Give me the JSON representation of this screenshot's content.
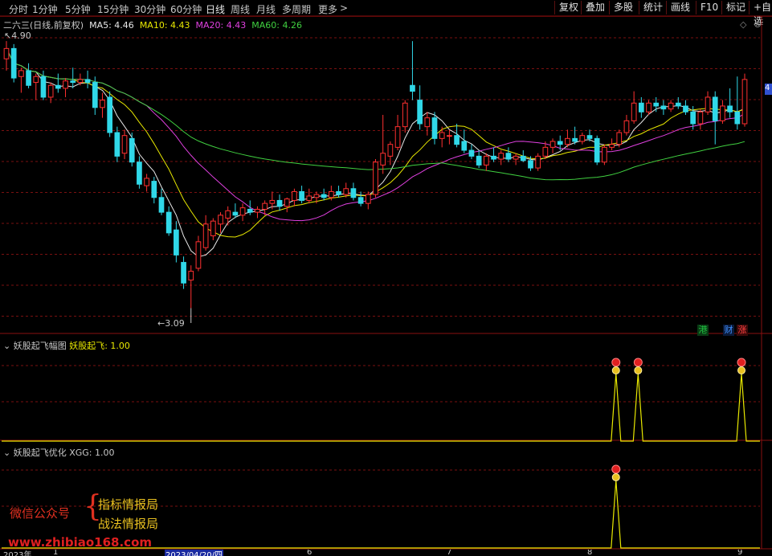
{
  "toolbar": {
    "timeframes": [
      "分时",
      "1分钟",
      "5分钟",
      "15分钟",
      "30分钟",
      "60分钟",
      "日线",
      "周线",
      "月线",
      "多周期",
      "更多"
    ],
    "more_arrow": ">",
    "right_buttons": [
      "复权",
      "叠加",
      "多股",
      "统计",
      "画线",
      "F10",
      "标记",
      "+自选"
    ]
  },
  "main_chart": {
    "stock_title": "二六三(日线,前复权)",
    "ma": [
      {
        "label": "MA5: 4.46",
        "color": "#e8e8e8"
      },
      {
        "label": "MA10: 4.43",
        "color": "#e8e800"
      },
      {
        "label": "MA20: 4.43",
        "color": "#e040e0"
      },
      {
        "label": "MA60: 4.26",
        "color": "#40d040"
      }
    ],
    "high_label": "4.90",
    "low_label": "3.09",
    "right_edge_price": "4",
    "badges": [
      {
        "text": "港",
        "color": "#20c040"
      },
      {
        "text": "财",
        "color": "#4090ff"
      },
      {
        "text": "涨",
        "color": "#ff4040"
      }
    ],
    "window_icons": [
      "diamond-icon",
      "close-circle-icon"
    ]
  },
  "indicator1": {
    "name": "妖股起飞幅图",
    "value_label": "妖股起飞: 1.00"
  },
  "indicator2": {
    "name": "妖股起飞优化",
    "value_label": "XGG: 1.00"
  },
  "watermark": {
    "wechat_label": "微信公众号",
    "brace": "{",
    "line1": "指标情报局",
    "line2": "战法情报局",
    "url": "www.zhibiao168.com"
  },
  "date_axis": {
    "left_year": "2023年",
    "tick_1": "1",
    "cursor_date": "2023/04/20/四",
    "tick_6": "6",
    "tick_7": "7",
    "tick_8": "8",
    "tick_9": "9"
  },
  "colors": {
    "up": "#ff3030",
    "down": "#30d8e8",
    "grid": "#7a1010",
    "signal": "#e8e800"
  },
  "chart_data": {
    "type": "candlestick",
    "ylim": [
      3.0,
      4.95
    ],
    "candles": [
      [
        4.78,
        4.9,
        4.7,
        4.85
      ],
      [
        4.85,
        4.88,
        4.62,
        4.65
      ],
      [
        4.66,
        4.72,
        4.55,
        4.7
      ],
      [
        4.7,
        4.75,
        4.58,
        4.6
      ],
      [
        4.62,
        4.68,
        4.5,
        4.66
      ],
      [
        4.66,
        4.7,
        4.5,
        4.52
      ],
      [
        4.52,
        4.62,
        4.48,
        4.6
      ],
      [
        4.6,
        4.68,
        4.55,
        4.58
      ],
      [
        4.58,
        4.65,
        4.52,
        4.63
      ],
      [
        4.63,
        4.72,
        4.58,
        4.62
      ],
      [
        4.62,
        4.68,
        4.6,
        4.64
      ],
      [
        4.64,
        4.7,
        4.58,
        4.62
      ],
      [
        4.62,
        4.66,
        4.4,
        4.45
      ],
      [
        4.45,
        4.55,
        4.38,
        4.5
      ],
      [
        4.52,
        4.56,
        4.25,
        4.28
      ],
      [
        4.28,
        4.32,
        4.08,
        4.12
      ],
      [
        4.14,
        4.3,
        4.1,
        4.26
      ],
      [
        4.24,
        4.28,
        4.05,
        4.08
      ],
      [
        4.08,
        4.12,
        3.9,
        3.93
      ],
      [
        3.92,
        4.0,
        3.88,
        3.97
      ],
      [
        3.95,
        3.98,
        3.8,
        3.84
      ],
      [
        3.84,
        3.9,
        3.72,
        3.74
      ],
      [
        3.74,
        3.78,
        3.58,
        3.6
      ],
      [
        3.62,
        3.68,
        3.4,
        3.45
      ],
      [
        3.4,
        3.44,
        3.22,
        3.26
      ],
      [
        3.28,
        3.38,
        3.09,
        3.34
      ],
      [
        3.36,
        3.58,
        3.34,
        3.54
      ],
      [
        3.5,
        3.72,
        3.48,
        3.66
      ],
      [
        3.58,
        3.7,
        3.55,
        3.68
      ],
      [
        3.66,
        3.74,
        3.6,
        3.72
      ],
      [
        3.7,
        3.78,
        3.65,
        3.75
      ],
      [
        3.74,
        3.8,
        3.7,
        3.72
      ],
      [
        3.72,
        3.8,
        3.68,
        3.77
      ],
      [
        3.76,
        3.82,
        3.72,
        3.74
      ],
      [
        3.74,
        3.78,
        3.7,
        3.76
      ],
      [
        3.76,
        3.82,
        3.72,
        3.8
      ],
      [
        3.8,
        3.88,
        3.76,
        3.82
      ],
      [
        3.82,
        3.86,
        3.75,
        3.78
      ],
      [
        3.78,
        3.84,
        3.74,
        3.83
      ],
      [
        3.82,
        3.9,
        3.78,
        3.88
      ],
      [
        3.88,
        3.92,
        3.8,
        3.82
      ],
      [
        3.82,
        3.9,
        3.8,
        3.85
      ],
      [
        3.84,
        3.88,
        3.8,
        3.86
      ],
      [
        3.86,
        3.9,
        3.82,
        3.84
      ],
      [
        3.84,
        3.92,
        3.82,
        3.88
      ],
      [
        3.88,
        3.92,
        3.84,
        3.86
      ],
      [
        3.86,
        3.94,
        3.84,
        3.9
      ],
      [
        3.9,
        3.94,
        3.82,
        3.84
      ],
      [
        3.84,
        3.88,
        3.78,
        3.8
      ],
      [
        3.8,
        3.88,
        3.76,
        3.86
      ],
      [
        3.86,
        4.1,
        3.84,
        4.08
      ],
      [
        4.06,
        4.4,
        4.0,
        4.14
      ],
      [
        4.12,
        4.22,
        4.06,
        4.2
      ],
      [
        4.18,
        4.4,
        4.16,
        4.32
      ],
      [
        4.32,
        4.5,
        4.28,
        4.48
      ],
      [
        4.6,
        4.9,
        4.5,
        4.56
      ],
      [
        4.5,
        4.6,
        4.3,
        4.34
      ],
      [
        4.32,
        4.42,
        4.26,
        4.38
      ],
      [
        4.38,
        4.42,
        4.2,
        4.24
      ],
      [
        4.24,
        4.32,
        4.18,
        4.28
      ],
      [
        4.26,
        4.3,
        4.2,
        4.26
      ],
      [
        4.26,
        4.34,
        4.18,
        4.2
      ],
      [
        4.22,
        4.3,
        4.14,
        4.16
      ],
      [
        4.16,
        4.2,
        4.1,
        4.12
      ],
      [
        4.12,
        4.16,
        4.04,
        4.06
      ],
      [
        4.06,
        4.14,
        4.02,
        4.12
      ],
      [
        4.12,
        4.18,
        4.08,
        4.1
      ],
      [
        4.1,
        4.16,
        4.06,
        4.14
      ],
      [
        4.14,
        4.18,
        4.08,
        4.1
      ],
      [
        4.1,
        4.14,
        4.06,
        4.12
      ],
      [
        4.12,
        4.16,
        4.08,
        4.09
      ],
      [
        4.09,
        4.12,
        4.02,
        4.04
      ],
      [
        4.04,
        4.14,
        4.02,
        4.12
      ],
      [
        4.12,
        4.22,
        4.1,
        4.18
      ],
      [
        4.18,
        4.24,
        4.14,
        4.22
      ],
      [
        4.22,
        4.26,
        4.16,
        4.2
      ],
      [
        4.2,
        4.3,
        4.18,
        4.24
      ],
      [
        4.24,
        4.32,
        4.2,
        4.22
      ],
      [
        4.22,
        4.28,
        4.2,
        4.26
      ],
      [
        4.26,
        4.3,
        4.22,
        4.24
      ],
      [
        4.24,
        4.26,
        4.06,
        4.08
      ],
      [
        4.08,
        4.2,
        4.06,
        4.18
      ],
      [
        4.18,
        4.24,
        4.16,
        4.2
      ],
      [
        4.2,
        4.3,
        4.18,
        4.28
      ],
      [
        4.28,
        4.4,
        4.26,
        4.36
      ],
      [
        4.36,
        4.56,
        4.34,
        4.48
      ],
      [
        4.48,
        4.52,
        4.38,
        4.42
      ],
      [
        4.42,
        4.5,
        4.4,
        4.48
      ],
      [
        4.48,
        4.52,
        4.42,
        4.46
      ],
      [
        4.46,
        4.5,
        4.4,
        4.44
      ],
      [
        4.44,
        4.5,
        4.42,
        4.48
      ],
      [
        4.48,
        4.52,
        4.44,
        4.46
      ],
      [
        4.46,
        4.5,
        4.4,
        4.42
      ],
      [
        4.42,
        4.46,
        4.3,
        4.34
      ],
      [
        4.34,
        4.44,
        4.3,
        4.42
      ],
      [
        4.42,
        4.56,
        4.4,
        4.52
      ],
      [
        4.52,
        4.56,
        4.2,
        4.36
      ],
      [
        4.36,
        4.5,
        4.34,
        4.46
      ],
      [
        4.46,
        4.58,
        4.38,
        4.42
      ],
      [
        4.42,
        4.66,
        4.3,
        4.34
      ],
      [
        4.34,
        4.68,
        4.32,
        4.64
      ]
    ],
    "signal_indices_indicator1": [
      83,
      86,
      100
    ],
    "signal_indices_indicator2": [
      83
    ],
    "cursor_index": 24
  }
}
